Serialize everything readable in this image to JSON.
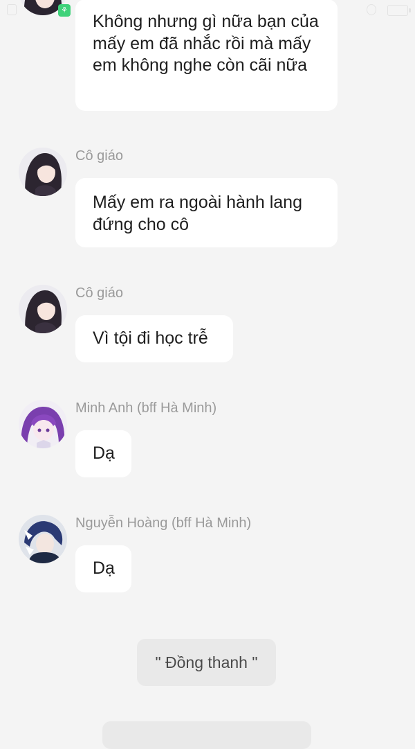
{
  "chat": {
    "messages": [
      {
        "sender": "",
        "text": "Không nhưng gì nữa bạn của mấy em đã nhắc rồi mà mấy em không nghe còn cãi nữa"
      },
      {
        "sender": "Cô giáo",
        "text": "Mấy em ra ngoài hành lang đứng cho cô"
      },
      {
        "sender": "Cô giáo",
        "text": "Vì tội đi học trễ"
      },
      {
        "sender": "Minh Anh (bff Hà Minh)",
        "text": "Dạ"
      },
      {
        "sender": "Nguyễn Hoàng (bff Hà Minh)",
        "text": "Dạ"
      }
    ],
    "narration": "\" Đồng thanh \""
  },
  "colors": {
    "background": "#f4f4f4",
    "bubble": "#ffffff",
    "narration_bubble": "#e9e9e9",
    "sender_name": "#9a9a9a"
  }
}
